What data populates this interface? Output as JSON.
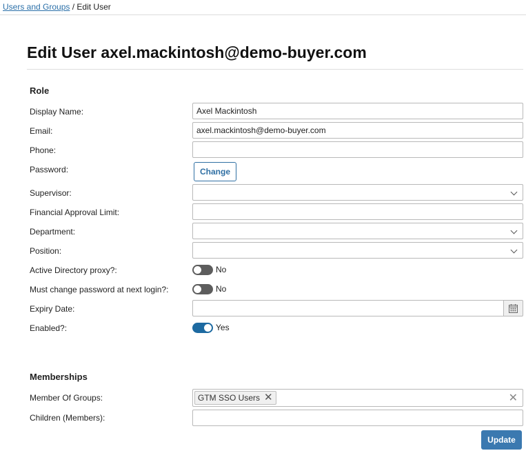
{
  "breadcrumb": {
    "parent": "Users and Groups",
    "separator": " / ",
    "current": "Edit User"
  },
  "page_title": "Edit User axel.mackintosh@demo-buyer.com",
  "role_section": {
    "title": "Role",
    "display_name": {
      "label": "Display Name:",
      "value": "Axel Mackintosh"
    },
    "email": {
      "label": "Email:",
      "value": "axel.mackintosh@demo-buyer.com"
    },
    "phone": {
      "label": "Phone:",
      "value": ""
    },
    "password": {
      "label": "Password:",
      "button": "Change"
    },
    "supervisor": {
      "label": "Supervisor:",
      "value": ""
    },
    "financial_approval_limit": {
      "label": "Financial Approval Limit:",
      "value": ""
    },
    "department": {
      "label": "Department:",
      "value": ""
    },
    "position": {
      "label": "Position:",
      "value": ""
    },
    "ad_proxy": {
      "label": "Active Directory proxy?:",
      "state": false,
      "text": "No"
    },
    "must_change_password": {
      "label": "Must change password at next login?:",
      "state": false,
      "text": "No"
    },
    "expiry_date": {
      "label": "Expiry Date:",
      "value": ""
    },
    "enabled": {
      "label": "Enabled?:",
      "state": true,
      "text": "Yes"
    }
  },
  "memberships_section": {
    "title": "Memberships",
    "member_of_groups": {
      "label": "Member Of Groups:",
      "chips": [
        "GTM SSO Users"
      ]
    },
    "children": {
      "label": "Children (Members):",
      "value": ""
    }
  },
  "actions": {
    "update": "Update"
  },
  "colors": {
    "primary": "#1d6aa1",
    "button": "#3b79b0",
    "link": "#2a6fa8"
  },
  "icons": {
    "chip_remove": "close-icon",
    "clear_all": "close-icon",
    "calendar": "calendar-icon",
    "dropdown": "chevron-down-icon"
  }
}
